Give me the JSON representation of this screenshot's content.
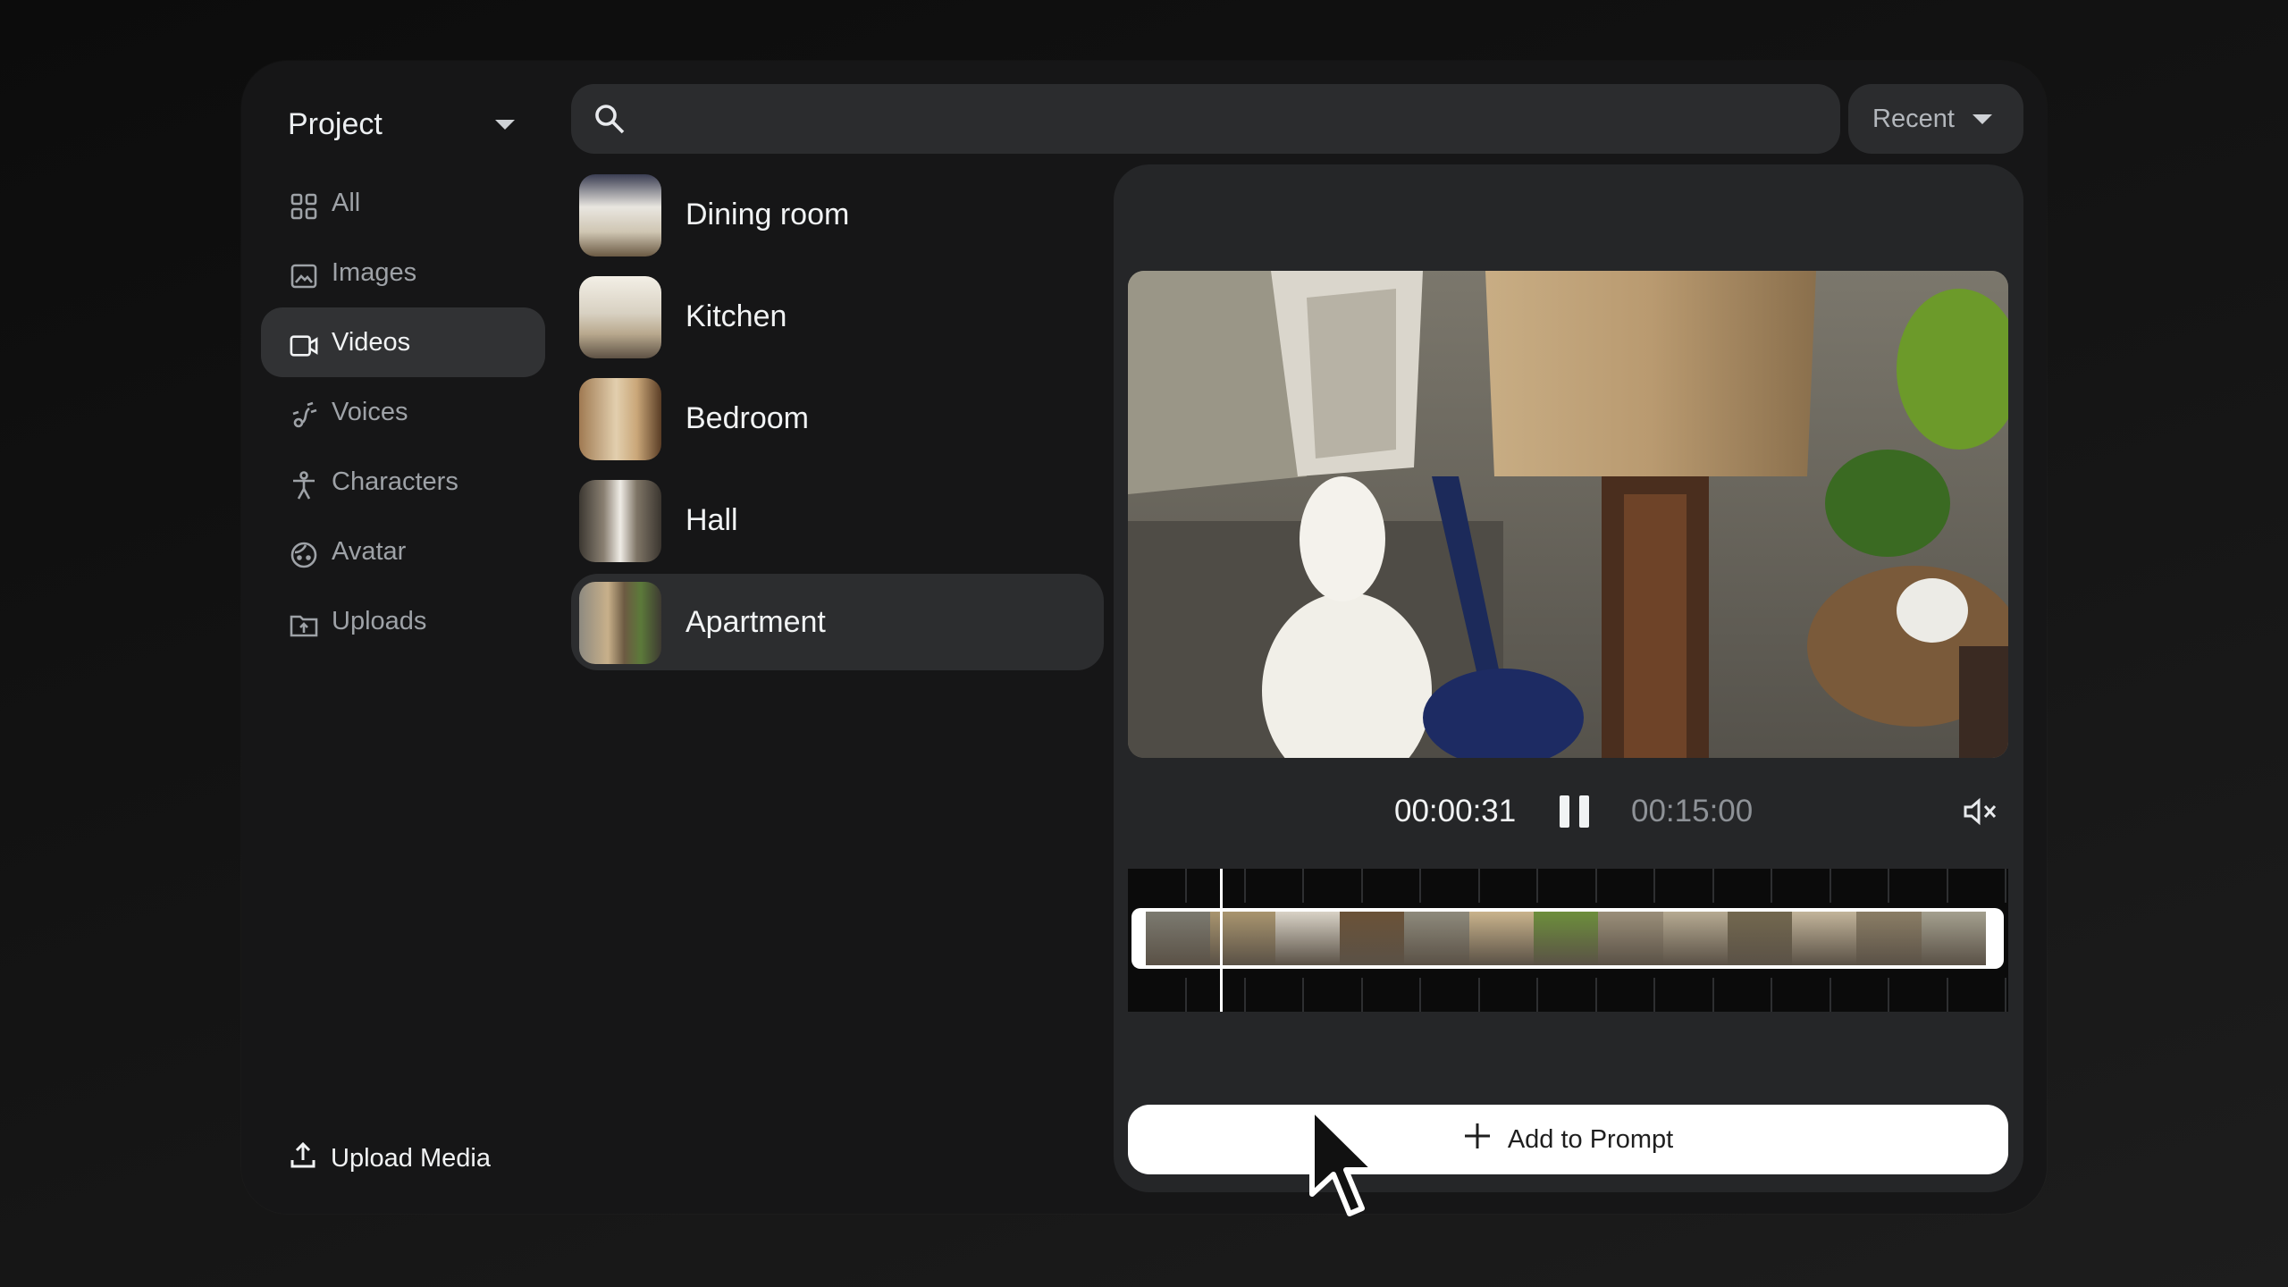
{
  "project": {
    "label": "Project"
  },
  "sidebar": {
    "items": [
      {
        "label": "All",
        "icon": "grid-icon"
      },
      {
        "label": "Images",
        "icon": "image-icon"
      },
      {
        "label": "Videos",
        "icon": "video-icon",
        "active": true
      },
      {
        "label": "Voices",
        "icon": "voice-icon"
      },
      {
        "label": "Characters",
        "icon": "character-icon"
      },
      {
        "label": "Avatar",
        "icon": "avatar-icon"
      },
      {
        "label": "Uploads",
        "icon": "uploads-folder-icon"
      }
    ],
    "upload_label": "Upload Media"
  },
  "search": {
    "placeholder": "",
    "value": ""
  },
  "sort": {
    "label": "Recent"
  },
  "media_list": [
    {
      "name": "Dining room"
    },
    {
      "name": "Kitchen"
    },
    {
      "name": "Bedroom"
    },
    {
      "name": "Hall"
    },
    {
      "name": "Apartment",
      "selected": true
    }
  ],
  "player": {
    "current_time": "00:00:31",
    "total_time": "00:15:00",
    "state": "playing",
    "muted": true
  },
  "add_button": {
    "label": "Add to Prompt"
  },
  "colors": {
    "background": "#161617",
    "panel": "#252628",
    "accent": "#ffffff",
    "active_item": "#313234"
  }
}
